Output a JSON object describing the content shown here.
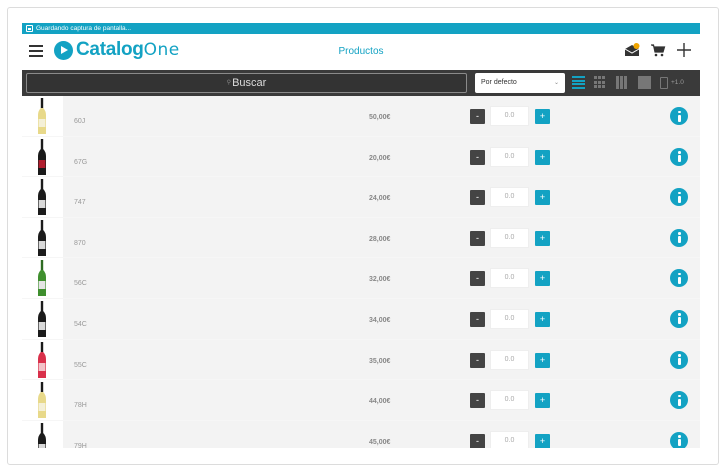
{
  "status_bar": {
    "text": "Guardando captura de pantalla..."
  },
  "app": {
    "logo_bold": "Catalog",
    "logo_light": "One",
    "page_title": "Productos",
    "icons": [
      "menu-icon",
      "logo-play-icon",
      "inbox-notification-icon",
      "cart-icon",
      "add-icon"
    ]
  },
  "toolbar": {
    "search_placeholder": "Buscar",
    "sort_selected": "Por defecto",
    "zoom_label": "+1.0",
    "view_icons": [
      "list-view-icon",
      "grid-view-icon",
      "columns-view-icon",
      "block-view-icon",
      "phone-view-icon"
    ]
  },
  "colors": {
    "accent": "#13a2c3",
    "toolbar": "#3a3a3a",
    "row_bg": "#f3f3f3",
    "minus": "#444444"
  },
  "products": [
    {
      "code": "60J",
      "price": "50,00€",
      "qty": "0.0",
      "bottle": "white"
    },
    {
      "code": "67G",
      "price": "20,00€",
      "qty": "0.0",
      "bottle": "red"
    },
    {
      "code": "747",
      "price": "24,00€",
      "qty": "0.0",
      "bottle": "dark"
    },
    {
      "code": "870",
      "price": "28,00€",
      "qty": "0.0",
      "bottle": "dark"
    },
    {
      "code": "56C",
      "price": "32,00€",
      "qty": "0.0",
      "bottle": "green"
    },
    {
      "code": "54C",
      "price": "34,00€",
      "qty": "0.0",
      "bottle": "dark"
    },
    {
      "code": "55C",
      "price": "35,00€",
      "qty": "0.0",
      "bottle": "rose"
    },
    {
      "code": "78H",
      "price": "44,00€",
      "qty": "0.0",
      "bottle": "white"
    },
    {
      "code": "79H",
      "price": "45,00€",
      "qty": "0.0",
      "bottle": "dark"
    }
  ],
  "row_buttons": {
    "minus": "-",
    "plus": "+"
  }
}
